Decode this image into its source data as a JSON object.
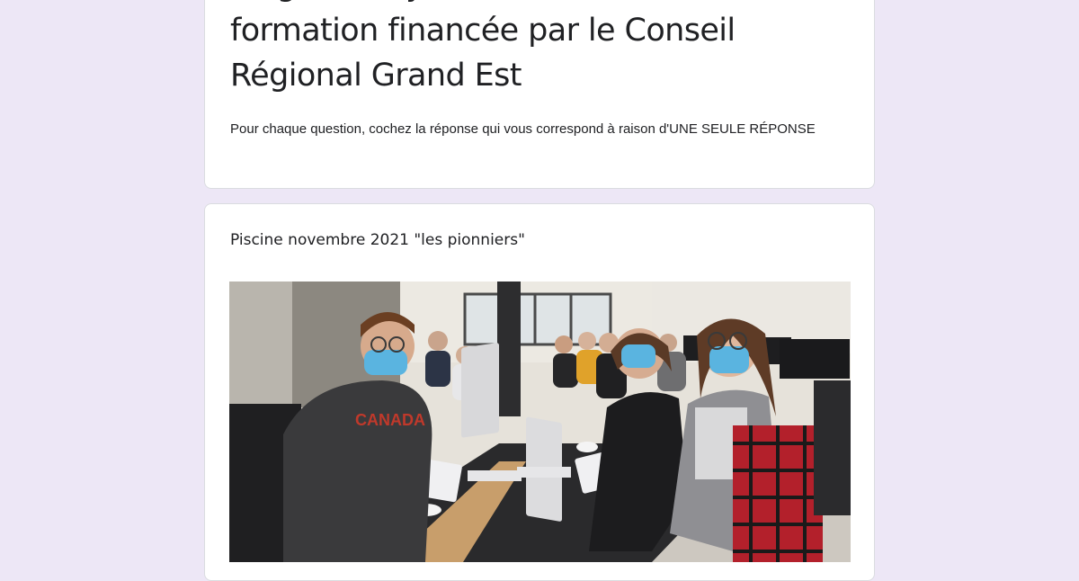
{
  "form": {
    "title": "stagiaires ayant suivi une action de formation financée par le Conseil Régional Grand Est",
    "description": "Pour chaque question, cochez la réponse qui vous correspond à raison d'UNE SEULE RÉPONSE"
  },
  "section": {
    "title": "Piscine novembre 2021 \"les pionniers\""
  },
  "photo": {
    "shirt_text": "CANADA",
    "colors": {
      "wall": "#e9e6df",
      "floor": "#cfcac2",
      "desk": "#2b2b2d",
      "mask": "#5ab4e0"
    }
  },
  "colors": {
    "page_background": "#ede7f6",
    "card_background": "#ffffff",
    "text": "#202124"
  }
}
